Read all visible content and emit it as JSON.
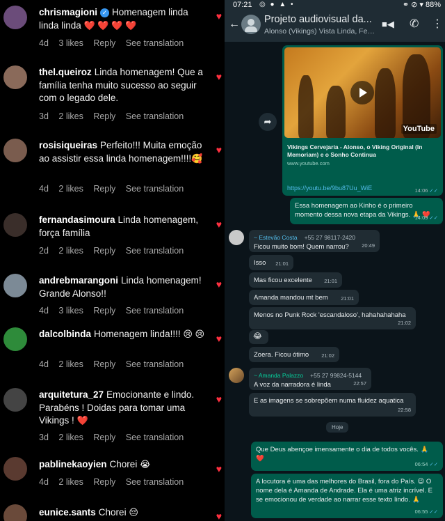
{
  "instagram": {
    "comments": [
      {
        "user": "chrismagioni",
        "verified": true,
        "text": "Homenagem linda linda linda",
        "emoji": "❤️ ❤️ ❤️ ❤️",
        "age": "4d",
        "likes": "3 likes",
        "reply": "Reply",
        "translate": "See translation",
        "avatar_color": "#6b4c7a"
      },
      {
        "user": "thel.queiroz",
        "text": "Linda homenagem! Que a família tenha muito sucesso ao seguir com o legado dele.",
        "emoji": "",
        "age": "3d",
        "likes": "2 likes",
        "reply": "Reply",
        "translate": "See translation",
        "avatar_color": "#8a6a5a"
      },
      {
        "user": "rosisiqueiras",
        "text": "Perfeito!!! Muita emoção ao assistir essa linda homenagem!!!!",
        "emoji": "🥰",
        "age": "4d",
        "likes": "2 likes",
        "reply": "Reply",
        "translate": "See translation",
        "avatar_color": "#7a5c4e"
      },
      {
        "user": "fernandasimoura",
        "text": "Linda homenagem, força família",
        "emoji": "",
        "age": "2d",
        "likes": "2 likes",
        "reply": "Reply",
        "translate": "See translation",
        "avatar_color": "#3a2e2a"
      },
      {
        "user": "andrebmarangoni",
        "text": "Linda homenagem! Grande Alonso!!",
        "emoji": "",
        "age": "4d",
        "likes": "3 likes",
        "reply": "Reply",
        "translate": "See translation",
        "avatar_color": "#7c8a96"
      },
      {
        "user": "dalcolbinda",
        "text": "Homenagem linda!!!!",
        "emoji": "😢 😢",
        "age": "4d",
        "likes": "2 likes",
        "reply": "Reply",
        "translate": "See translation",
        "avatar_color": "#2e8b3a"
      },
      {
        "user": "arquitetura_27",
        "text": "Emocionante e lindo. Parabéns ! Doidas para tomar uma Vikings !",
        "emoji": "❤️",
        "age": "3d",
        "likes": "2 likes",
        "reply": "Reply",
        "translate": "See translation",
        "avatar_color": "#444"
      },
      {
        "user": "pablinekaoyien",
        "text": "Chorei",
        "emoji": "😭",
        "age": "4d",
        "likes": "2 likes",
        "reply": "Reply",
        "translate": "See translation",
        "avatar_color": "#5a3a30"
      },
      {
        "user": "eunice.sants",
        "text": "Chorei",
        "emoji": "😔",
        "avatar_color": "#6a4a3a"
      }
    ]
  },
  "whatsapp": {
    "status": {
      "time": "07:21",
      "icons": "◎ ● ▲ •",
      "right": "⚭ ⊘ ▾ 88%"
    },
    "header": {
      "back": "←",
      "title": "Projeto audiovisual da...",
      "subtitle": "Alonso (Vikings) Vista Linda, Feli...",
      "video_icon": "■◀",
      "call_icon": "✆",
      "menu_icon": "⋮"
    },
    "video": {
      "title": "Vikings Cervejaria - Alonso, o Viking Original (In Memoriam) e o Sonho Continua",
      "domain": "www.youtube.com",
      "link": "https://youtu.be/9bu87Uu_WiE",
      "time": "14:06",
      "ticks": "✓✓",
      "yt_label": "YouTube",
      "forward": "➦"
    },
    "messages": [
      {
        "text": "Essa homenagem ao Kinho é o primeiro momento dessa nova etapa da Vikings.",
        "emoji": "🙏 ❤️",
        "time": "14:09",
        "ticks": "✓✓"
      },
      {
        "sender": "~ Estevão Costa",
        "phone": "+55 27 98117-2420",
        "text": "Ficou muito bom! Quem narrou?",
        "time": "20:49"
      },
      {
        "text": "Isso",
        "time": "21:01"
      },
      {
        "text": "Mas ficou excelente",
        "time": "21:01"
      },
      {
        "text": "Amanda mandou mt bem",
        "time": "21:01"
      },
      {
        "text": "Menos no Punk Rock 'escandaloso', hahahahahaha",
        "time": "21:02"
      },
      {
        "text": "😂",
        "time": ""
      },
      {
        "text": "Zoera. Ficou ótimo",
        "time": "21:02"
      },
      {
        "sender": "~ Amanda Palazzo",
        "phone": "+55 27 99824-5144",
        "text": "A voz da narradora é linda",
        "time": "22:57"
      },
      {
        "text": "E as imagens se sobrepõem numa fluidez aquatica",
        "time": "22:58"
      },
      {
        "text": "Que Deus abençoe imensamente o dia de todos vocês.",
        "emoji": "🙏 ❤️",
        "time": "06:54",
        "ticks": "✓✓"
      },
      {
        "text": "A locutora é uma das melhores do Brasil, fora do País. 😉 O nome dela é Amanda de Andrade. Ela é uma atriz incrível. E se emocionou de verdade ao narrar esse texto lindo.",
        "emoji": "🙏",
        "time": "06:55",
        "ticks": "✓✓"
      }
    ],
    "date_pill": "Hoje"
  }
}
